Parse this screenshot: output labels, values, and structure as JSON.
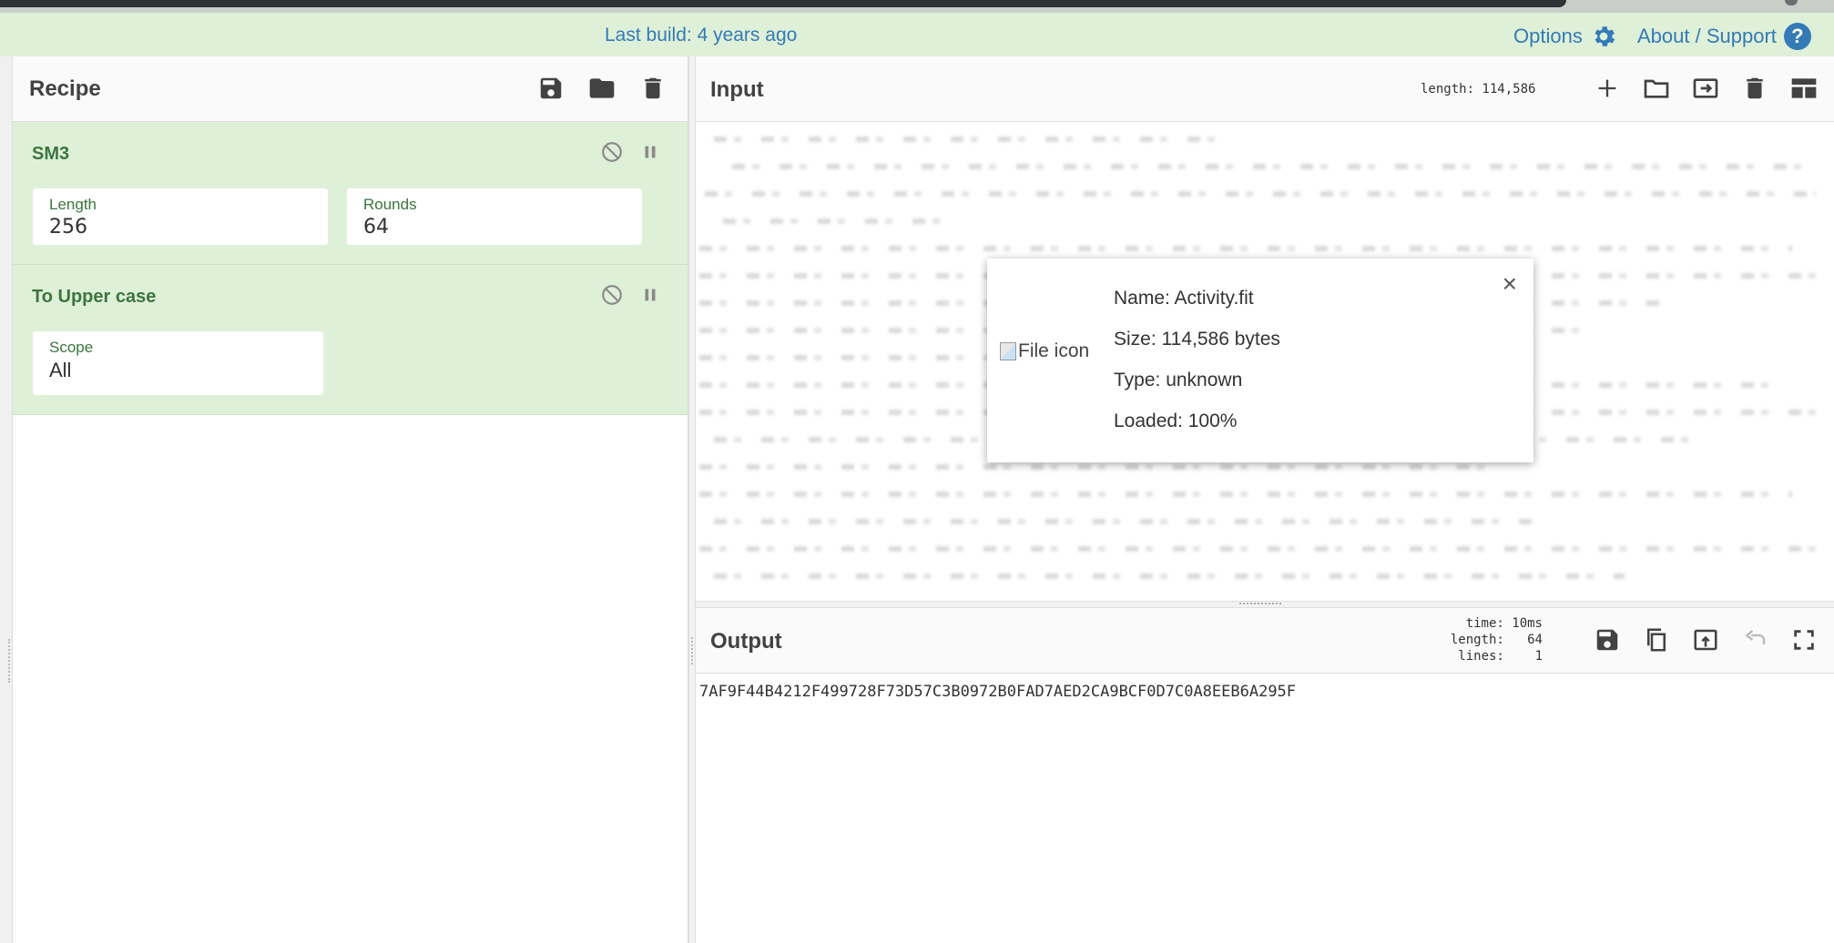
{
  "banner": {
    "last_build": "Last build: 4 years ago",
    "options_label": "Options",
    "about_label": "About / Support",
    "options_icon": "gear-icon",
    "help_icon": "help-icon",
    "accent_color": "#337ab7"
  },
  "recipe": {
    "title": "Recipe",
    "icons": [
      "save-icon",
      "folder-icon",
      "trash-icon"
    ],
    "operations": [
      {
        "name": "SM3",
        "args": [
          {
            "label": "Length",
            "value": "256"
          },
          {
            "label": "Rounds",
            "value": "64"
          }
        ]
      },
      {
        "name": "To Upper case",
        "args": [
          {
            "label": "Scope",
            "value": "All"
          }
        ]
      }
    ]
  },
  "input": {
    "title": "Input",
    "length": "length: 114,586",
    "icons": [
      "plus-icon",
      "folder-icon",
      "import-icon",
      "trash-icon",
      "layout-icon"
    ]
  },
  "output": {
    "title": "Output",
    "time": "time: 10ms",
    "length": "length:   64",
    "lines": "lines:    1",
    "value": "7AF9F44B4212F499728F73D57C3B0972B0FAD7AED2CA9BCF0D7C0A8EEB6A295F",
    "icons": [
      "save-icon",
      "copy-icon",
      "replace-input-icon",
      "undo-icon",
      "maximize-icon"
    ]
  },
  "file_info": {
    "icon_alt": "File icon",
    "name": "Name: Activity.fit",
    "size": "Size: 114,586 bytes",
    "type": "Type: unknown",
    "loaded": "Loaded: 100%",
    "close": "×"
  }
}
